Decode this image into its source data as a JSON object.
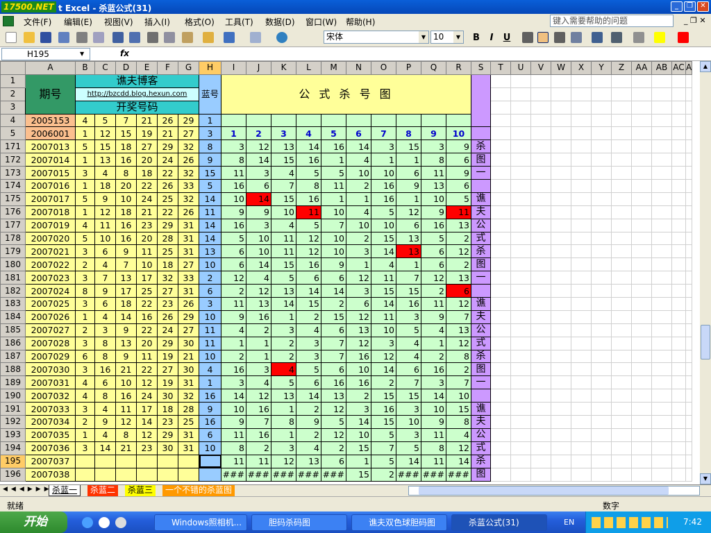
{
  "titlebar": {
    "logo": "17500.NET",
    "title": "t Excel - 杀蓝公式(31)"
  },
  "menu": [
    "文件(F)",
    "编辑(E)",
    "视图(V)",
    "插入(I)",
    "格式(O)",
    "工具(T)",
    "数据(D)",
    "窗口(W)",
    "帮助(H)"
  ],
  "help_placeholder": "键入需要帮助的问题",
  "font": {
    "name": "宋体",
    "size": "10"
  },
  "namebox": "H195",
  "fx": "fx",
  "columns": [
    "A",
    "B",
    "C",
    "D",
    "E",
    "F",
    "G",
    "H",
    "I",
    "J",
    "K",
    "L",
    "M",
    "N",
    "O",
    "P",
    "Q",
    "R",
    "S",
    "T",
    "U",
    "V",
    "W",
    "X",
    "Y",
    "Z",
    "AA",
    "AB",
    "AC",
    "A"
  ],
  "header": {
    "period": "期号",
    "blog": "谯夫博客",
    "url": "http://bzcdd.blog.hexun.com",
    "draw": "开奖号码",
    "blue": "蓝号",
    "formula_title": "公 式 杀 号 图"
  },
  "row4": {
    "num": "4",
    "id": "2005153",
    "reds": [
      "4",
      "5",
      "7",
      "21",
      "26",
      "29"
    ],
    "blue": "1"
  },
  "row5": {
    "num": "5",
    "id": "2006001",
    "reds": [
      "1",
      "12",
      "15",
      "19",
      "21",
      "27"
    ],
    "blue": "3",
    "cols": [
      "1",
      "2",
      "3",
      "4",
      "5",
      "6",
      "7",
      "8",
      "9",
      "10"
    ]
  },
  "rows": [
    {
      "n": "171",
      "id": "2007013",
      "r": [
        "5",
        "15",
        "18",
        "27",
        "29",
        "32"
      ],
      "b": "8",
      "k": [
        "3",
        "12",
        "13",
        "14",
        "16",
        "14",
        "3",
        "15",
        "3",
        "9"
      ],
      "hi": [],
      "s": "杀"
    },
    {
      "n": "172",
      "id": "2007014",
      "r": [
        "1",
        "13",
        "16",
        "20",
        "24",
        "26"
      ],
      "b": "9",
      "k": [
        "8",
        "14",
        "15",
        "16",
        "1",
        "4",
        "1",
        "1",
        "8",
        "6"
      ],
      "hi": [],
      "s": "图"
    },
    {
      "n": "173",
      "id": "2007015",
      "r": [
        "3",
        "4",
        "8",
        "18",
        "22",
        "32"
      ],
      "b": "15",
      "k": [
        "11",
        "3",
        "4",
        "5",
        "5",
        "10",
        "10",
        "6",
        "11",
        "9"
      ],
      "hi": [],
      "s": "一"
    },
    {
      "n": "174",
      "id": "2007016",
      "r": [
        "1",
        "18",
        "20",
        "22",
        "26",
        "33"
      ],
      "b": "5",
      "k": [
        "16",
        "6",
        "7",
        "8",
        "11",
        "2",
        "16",
        "9",
        "13",
        "6"
      ],
      "hi": [],
      "s": ""
    },
    {
      "n": "175",
      "id": "2007017",
      "r": [
        "5",
        "9",
        "10",
        "24",
        "25",
        "32"
      ],
      "b": "14",
      "k": [
        "10",
        "14",
        "15",
        "16",
        "1",
        "1",
        "16",
        "1",
        "10",
        "5"
      ],
      "hi": [
        1
      ],
      "s": "谯"
    },
    {
      "n": "176",
      "id": "2007018",
      "r": [
        "1",
        "12",
        "18",
        "21",
        "22",
        "26"
      ],
      "b": "11",
      "k": [
        "9",
        "9",
        "10",
        "11",
        "10",
        "4",
        "5",
        "12",
        "9",
        "11"
      ],
      "hi": [
        3,
        9
      ],
      "s": "夫"
    },
    {
      "n": "177",
      "id": "2007019",
      "r": [
        "4",
        "11",
        "16",
        "23",
        "29",
        "31"
      ],
      "b": "14",
      "k": [
        "16",
        "3",
        "4",
        "5",
        "7",
        "10",
        "10",
        "6",
        "16",
        "13"
      ],
      "hi": [],
      "s": "公"
    },
    {
      "n": "178",
      "id": "2007020",
      "r": [
        "5",
        "10",
        "16",
        "20",
        "28",
        "31"
      ],
      "b": "14",
      "k": [
        "5",
        "10",
        "11",
        "12",
        "10",
        "2",
        "15",
        "13",
        "5",
        "2"
      ],
      "hi": [],
      "s": "式"
    },
    {
      "n": "179",
      "id": "2007021",
      "r": [
        "3",
        "6",
        "9",
        "11",
        "25",
        "31"
      ],
      "b": "13",
      "k": [
        "6",
        "10",
        "11",
        "12",
        "10",
        "3",
        "14",
        "13",
        "6",
        "12"
      ],
      "hi": [
        7
      ],
      "s": "杀"
    },
    {
      "n": "180",
      "id": "2007022",
      "r": [
        "2",
        "4",
        "7",
        "10",
        "18",
        "27"
      ],
      "b": "10",
      "k": [
        "6",
        "14",
        "15",
        "16",
        "9",
        "1",
        "4",
        "1",
        "6",
        "2"
      ],
      "hi": [],
      "s": "图"
    },
    {
      "n": "181",
      "id": "2007023",
      "r": [
        "3",
        "7",
        "13",
        "17",
        "32",
        "33"
      ],
      "b": "2",
      "k": [
        "12",
        "4",
        "5",
        "6",
        "6",
        "12",
        "11",
        "7",
        "12",
        "13"
      ],
      "hi": [],
      "s": "一"
    },
    {
      "n": "182",
      "id": "2007024",
      "r": [
        "8",
        "9",
        "17",
        "25",
        "27",
        "31"
      ],
      "b": "6",
      "k": [
        "2",
        "12",
        "13",
        "14",
        "14",
        "3",
        "15",
        "15",
        "2",
        "6"
      ],
      "hi": [
        9
      ],
      "s": ""
    },
    {
      "n": "183",
      "id": "2007025",
      "r": [
        "3",
        "6",
        "18",
        "22",
        "23",
        "26"
      ],
      "b": "3",
      "k": [
        "11",
        "13",
        "14",
        "15",
        "2",
        "6",
        "14",
        "16",
        "11",
        "12"
      ],
      "hi": [],
      "s": "谯"
    },
    {
      "n": "184",
      "id": "2007026",
      "r": [
        "1",
        "4",
        "14",
        "16",
        "26",
        "29"
      ],
      "b": "10",
      "k": [
        "9",
        "16",
        "1",
        "2",
        "15",
        "12",
        "11",
        "3",
        "9",
        "7"
      ],
      "hi": [],
      "s": "夫"
    },
    {
      "n": "185",
      "id": "2007027",
      "r": [
        "2",
        "3",
        "9",
        "22",
        "24",
        "27"
      ],
      "b": "11",
      "k": [
        "4",
        "2",
        "3",
        "4",
        "6",
        "13",
        "10",
        "5",
        "4",
        "13"
      ],
      "hi": [],
      "s": "公"
    },
    {
      "n": "186",
      "id": "2007028",
      "r": [
        "3",
        "8",
        "13",
        "20",
        "29",
        "30"
      ],
      "b": "11",
      "k": [
        "1",
        "1",
        "2",
        "3",
        "7",
        "12",
        "3",
        "4",
        "1",
        "12"
      ],
      "hi": [],
      "s": "式"
    },
    {
      "n": "187",
      "id": "2007029",
      "r": [
        "6",
        "8",
        "9",
        "11",
        "19",
        "21"
      ],
      "b": "10",
      "k": [
        "2",
        "1",
        "2",
        "3",
        "7",
        "16",
        "12",
        "4",
        "2",
        "8"
      ],
      "hi": [],
      "s": "杀"
    },
    {
      "n": "188",
      "id": "2007030",
      "r": [
        "3",
        "16",
        "21",
        "22",
        "27",
        "30"
      ],
      "b": "4",
      "k": [
        "16",
        "3",
        "4",
        "5",
        "6",
        "10",
        "14",
        "6",
        "16",
        "2"
      ],
      "hi": [
        2
      ],
      "s": "图"
    },
    {
      "n": "189",
      "id": "2007031",
      "r": [
        "4",
        "6",
        "10",
        "12",
        "19",
        "31"
      ],
      "b": "1",
      "k": [
        "3",
        "4",
        "5",
        "6",
        "16",
        "16",
        "2",
        "7",
        "3",
        "7"
      ],
      "hi": [],
      "s": "一"
    },
    {
      "n": "190",
      "id": "2007032",
      "r": [
        "4",
        "8",
        "16",
        "24",
        "30",
        "32"
      ],
      "b": "16",
      "k": [
        "14",
        "12",
        "13",
        "14",
        "13",
        "2",
        "15",
        "15",
        "14",
        "10"
      ],
      "hi": [],
      "s": ""
    },
    {
      "n": "191",
      "id": "2007033",
      "r": [
        "3",
        "4",
        "11",
        "17",
        "18",
        "28"
      ],
      "b": "9",
      "k": [
        "10",
        "16",
        "1",
        "2",
        "12",
        "3",
        "16",
        "3",
        "10",
        "15"
      ],
      "hi": [],
      "s": "谯"
    },
    {
      "n": "192",
      "id": "2007034",
      "r": [
        "2",
        "9",
        "12",
        "14",
        "23",
        "25"
      ],
      "b": "16",
      "k": [
        "9",
        "7",
        "8",
        "9",
        "5",
        "14",
        "15",
        "10",
        "9",
        "8"
      ],
      "hi": [],
      "s": "夫"
    },
    {
      "n": "193",
      "id": "2007035",
      "r": [
        "1",
        "4",
        "8",
        "12",
        "29",
        "31"
      ],
      "b": "6",
      "k": [
        "11",
        "16",
        "1",
        "2",
        "12",
        "10",
        "5",
        "3",
        "11",
        "4"
      ],
      "hi": [],
      "s": "公"
    },
    {
      "n": "194",
      "id": "2007036",
      "r": [
        "3",
        "14",
        "21",
        "23",
        "30",
        "31"
      ],
      "b": "10",
      "k": [
        "8",
        "2",
        "3",
        "4",
        "2",
        "15",
        "7",
        "5",
        "8",
        "12"
      ],
      "hi": [],
      "s": "式"
    },
    {
      "n": "195",
      "id": "2007037",
      "r": [
        "",
        "",
        "",
        "",
        "",
        ""
      ],
      "b": "",
      "k": [
        "11",
        "11",
        "12",
        "13",
        "6",
        "1",
        "5",
        "14",
        "11",
        "14"
      ],
      "hi": [],
      "s": "杀",
      "sel": true
    },
    {
      "n": "196",
      "id": "2007038",
      "r": [
        "",
        "",
        "",
        "",
        "",
        ""
      ],
      "b": "",
      "k": [
        "###",
        "###",
        "###",
        "###",
        "###",
        "15",
        "2",
        "###",
        "###",
        "###"
      ],
      "hi": [],
      "s": "图"
    }
  ],
  "sheettabs": [
    "杀蓝一",
    "杀蓝二",
    "杀蓝三",
    "一个不错的杀蓝图"
  ],
  "status": {
    "ready": "就绪",
    "mode": "数字"
  },
  "taskbar": {
    "start": "开始",
    "tasks": [
      "Windows照相机...",
      "胆码杀码图",
      "谯夫双色球胆码图",
      "杀蓝公式(31)"
    ],
    "lang": "EN",
    "time": "7:42"
  }
}
